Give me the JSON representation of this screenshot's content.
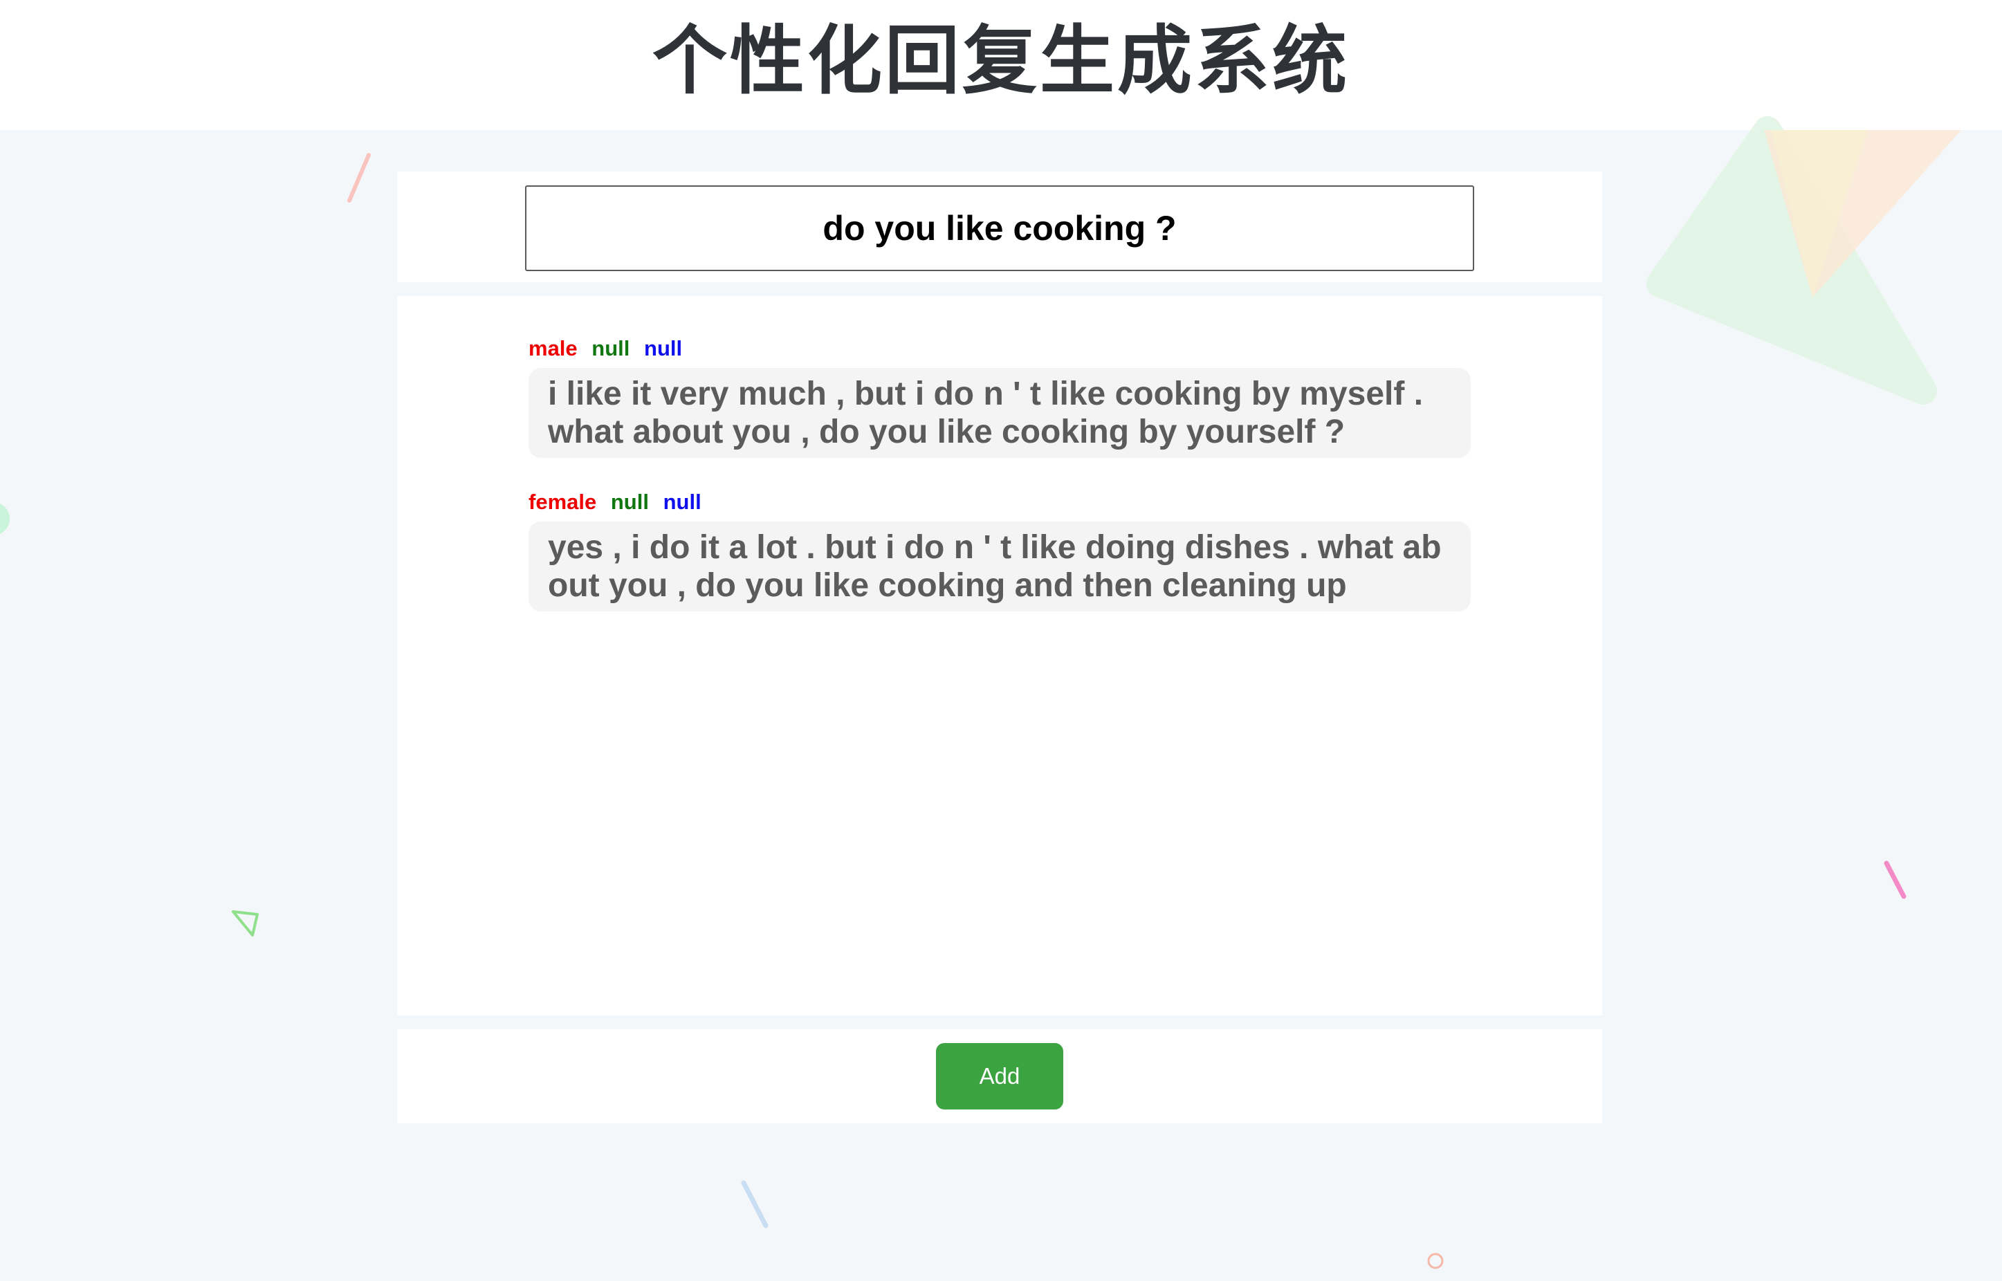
{
  "header": {
    "title": "个性化回复生成系统"
  },
  "query": {
    "value": "do you like cooking ?"
  },
  "messages": [
    {
      "tags": [
        "male",
        "null",
        "null"
      ],
      "text": "i like it very much , but i do n ' t like cooking by myself . what about you , do you like cooking by yourself ?"
    },
    {
      "tags": [
        "female",
        "null",
        "null"
      ],
      "text": "yes , i do it a lot . but i do n ' t like doing dishes . what about you , do you like cooking and then cleaning up"
    }
  ],
  "actions": {
    "add_label": "Add"
  },
  "colors": {
    "tag_1": "#ee0000",
    "tag_2": "#117711",
    "tag_3": "#1010ee",
    "add_button": "#3ba340",
    "title": "#2f3237",
    "bubble_text": "#5b5b5b"
  }
}
